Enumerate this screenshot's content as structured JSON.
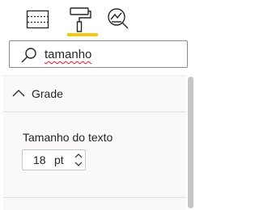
{
  "toolbar": {
    "tabs": [
      {
        "id": "fields",
        "icon": "table-fields-icon",
        "selected": false
      },
      {
        "id": "format",
        "icon": "paint-roller-icon",
        "selected": true
      },
      {
        "id": "analytics",
        "icon": "analytics-magnifier-icon",
        "selected": false
      }
    ],
    "accent_color": "#f2c811"
  },
  "search": {
    "value": "tamanho",
    "icon": "search-icon"
  },
  "section": {
    "title": "Grade",
    "expanded": true,
    "property": {
      "label": "Tamanho do texto",
      "value": "18",
      "unit": "pt"
    }
  }
}
